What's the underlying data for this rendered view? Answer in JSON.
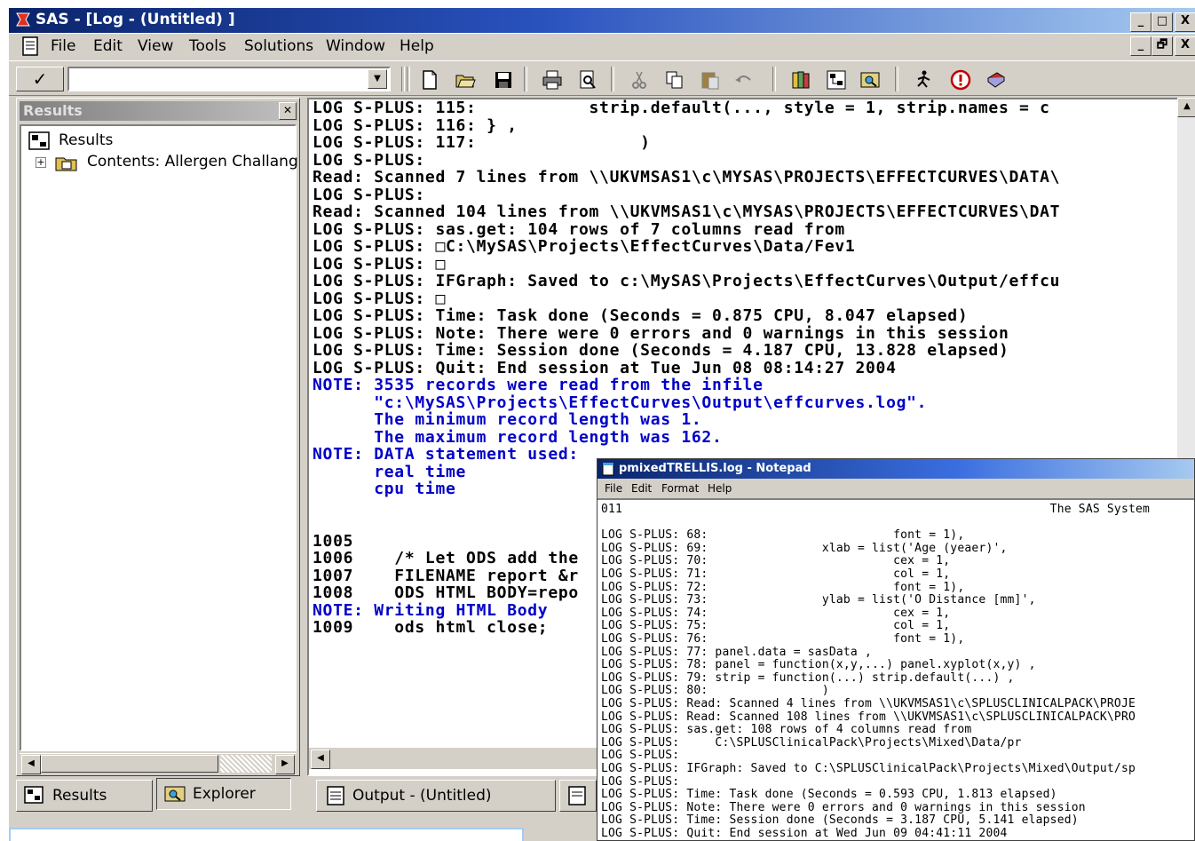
{
  "window": {
    "title": "SAS - [Log - (Untitled) ]",
    "controls": [
      "_",
      "□",
      "X"
    ],
    "doc_controls": [
      "_",
      "🗗",
      "X"
    ]
  },
  "menu": {
    "items": [
      "File",
      "Edit",
      "View",
      "Tools",
      "Solutions",
      "Window",
      "Help"
    ]
  },
  "toolbar": {
    "command_value": "",
    "check_label": "✓"
  },
  "results": {
    "header": "Results",
    "root_label": "Results",
    "child_label": "Contents:  Allergen Challang",
    "expander": "+"
  },
  "tabs": {
    "results": "Results",
    "explorer": "Explorer",
    "output": "Output - (Untitled)"
  },
  "log": {
    "lines": [
      {
        "t": "LOG S-PLUS: 115:           strip.default(..., style = 1, strip.names = c",
        "c": "blk"
      },
      {
        "t": "LOG S-PLUS: 116: } ,",
        "c": "blk"
      },
      {
        "t": "LOG S-PLUS: 117:                )",
        "c": "blk"
      },
      {
        "t": "LOG S-PLUS:",
        "c": "blk"
      },
      {
        "t": "Read: Scanned 7 lines from \\\\UKVMSAS1\\c\\MYSAS\\PROJECTS\\EFFECTCURVES\\DATA\\",
        "c": "blk"
      },
      {
        "t": "LOG S-PLUS:",
        "c": "blk"
      },
      {
        "t": "Read: Scanned 104 lines from \\\\UKVMSAS1\\c\\MYSAS\\PROJECTS\\EFFECTCURVES\\DAT",
        "c": "blk"
      },
      {
        "t": "LOG S-PLUS: sas.get: 104 rows of 7 columns read from",
        "c": "blk"
      },
      {
        "t": "LOG S-PLUS: □C:\\MySAS\\Projects\\EffectCurves\\Data/Fev1",
        "c": "blk"
      },
      {
        "t": "LOG S-PLUS: □",
        "c": "blk"
      },
      {
        "t": "LOG S-PLUS: IFGraph: Saved to c:\\MySAS\\Projects\\EffectCurves\\Output/effcu",
        "c": "blk"
      },
      {
        "t": "LOG S-PLUS: □",
        "c": "blk"
      },
      {
        "t": "LOG S-PLUS: Time: Task done (Seconds = 0.875 CPU, 8.047 elapsed)",
        "c": "blk"
      },
      {
        "t": "LOG S-PLUS: Note: There were 0 errors and 0 warnings in this session",
        "c": "blk"
      },
      {
        "t": "LOG S-PLUS: Time: Session done (Seconds = 4.187 CPU, 13.828 elapsed)",
        "c": "blk"
      },
      {
        "t": "LOG S-PLUS: Quit: End session at Tue Jun 08 08:14:27 2004",
        "c": "blk"
      },
      {
        "t": "NOTE: 3535 records were read from the infile",
        "c": "blu"
      },
      {
        "t": "      \"c:\\MySAS\\Projects\\EffectCurves\\Output\\effcurves.log\".",
        "c": "blu"
      },
      {
        "t": "      The minimum record length was 1.",
        "c": "blu"
      },
      {
        "t": "      The maximum record length was 162.",
        "c": "blu"
      },
      {
        "t": "NOTE: DATA statement used:",
        "c": "blu"
      },
      {
        "t": "      real time",
        "c": "blu"
      },
      {
        "t": "      cpu time",
        "c": "blu"
      },
      {
        "t": "",
        "c": "blk"
      },
      {
        "t": "",
        "c": "blk"
      },
      {
        "t": "1005",
        "c": "blk"
      },
      {
        "t": "1006    /* Let ODS add the",
        "c": "blk"
      },
      {
        "t": "1007    FILENAME report &r",
        "c": "blk"
      },
      {
        "t": "1008    ODS HTML BODY=repo",
        "c": "blk"
      },
      {
        "t": "NOTE: Writing HTML Body",
        "c": "blu"
      },
      {
        "t": "1009    ods html close;",
        "c": "blk"
      }
    ]
  },
  "notepad": {
    "title": "pmixedTRELLIS.log - Notepad",
    "menu": [
      "File",
      "Edit",
      "Format",
      "Help"
    ],
    "lines": [
      "011                                                            The SAS System",
      "",
      "LOG S-PLUS: 68:                          font = 1),",
      "LOG S-PLUS: 69:                xlab = list('Age (yeaer)',",
      "LOG S-PLUS: 70:                          cex = 1,",
      "LOG S-PLUS: 71:                          col = 1,",
      "LOG S-PLUS: 72:                          font = 1),",
      "LOG S-PLUS: 73:                ylab = list('O Distance [mm]',",
      "LOG S-PLUS: 74:                          cex = 1,",
      "LOG S-PLUS: 75:                          col = 1,",
      "LOG S-PLUS: 76:                          font = 1),",
      "LOG S-PLUS: 77: panel.data = sasData ,",
      "LOG S-PLUS: 78: panel = function(x,y,...) panel.xyplot(x,y) ,",
      "LOG S-PLUS: 79: strip = function(...) strip.default(...) ,",
      "LOG S-PLUS: 80:                )",
      "LOG S-PLUS: Read: Scanned 4 lines from \\\\UKVMSAS1\\c\\SPLUSCLINICALPACK\\PROJE",
      "LOG S-PLUS: Read: Scanned 108 lines from \\\\UKVMSAS1\\c\\SPLUSCLINICALPACK\\PRO",
      "LOG S-PLUS: sas.get: 108 rows of 4 columns read from",
      "LOG S-PLUS:     C:\\SPLUSClinicalPack\\Projects\\Mixed\\Data/pr",
      "LOG S-PLUS:",
      "LOG S-PLUS: IFGraph: Saved to C:\\SPLUSClinicalPack\\Projects\\Mixed\\Output/sp",
      "LOG S-PLUS:",
      "LOG S-PLUS: Time: Task done (Seconds = 0.593 CPU, 1.813 elapsed)",
      "LOG S-PLUS: Note: There were 0 errors and 0 warnings in this session",
      "LOG S-PLUS: Time: Session done (Seconds = 3.187 CPU, 5.141 elapsed)",
      "LOG S-PLUS: Quit: End session at Wed Jun 09 04:41:11 2004"
    ]
  },
  "icons": {
    "app": "sas-icon",
    "new": "new-file-icon",
    "open": "open-folder-icon",
    "save": "save-disk-icon",
    "print": "printer-icon",
    "preview": "print-preview-icon",
    "cut": "scissors-icon",
    "copy": "copy-icon",
    "paste": "paste-icon",
    "undo": "undo-icon"
  }
}
